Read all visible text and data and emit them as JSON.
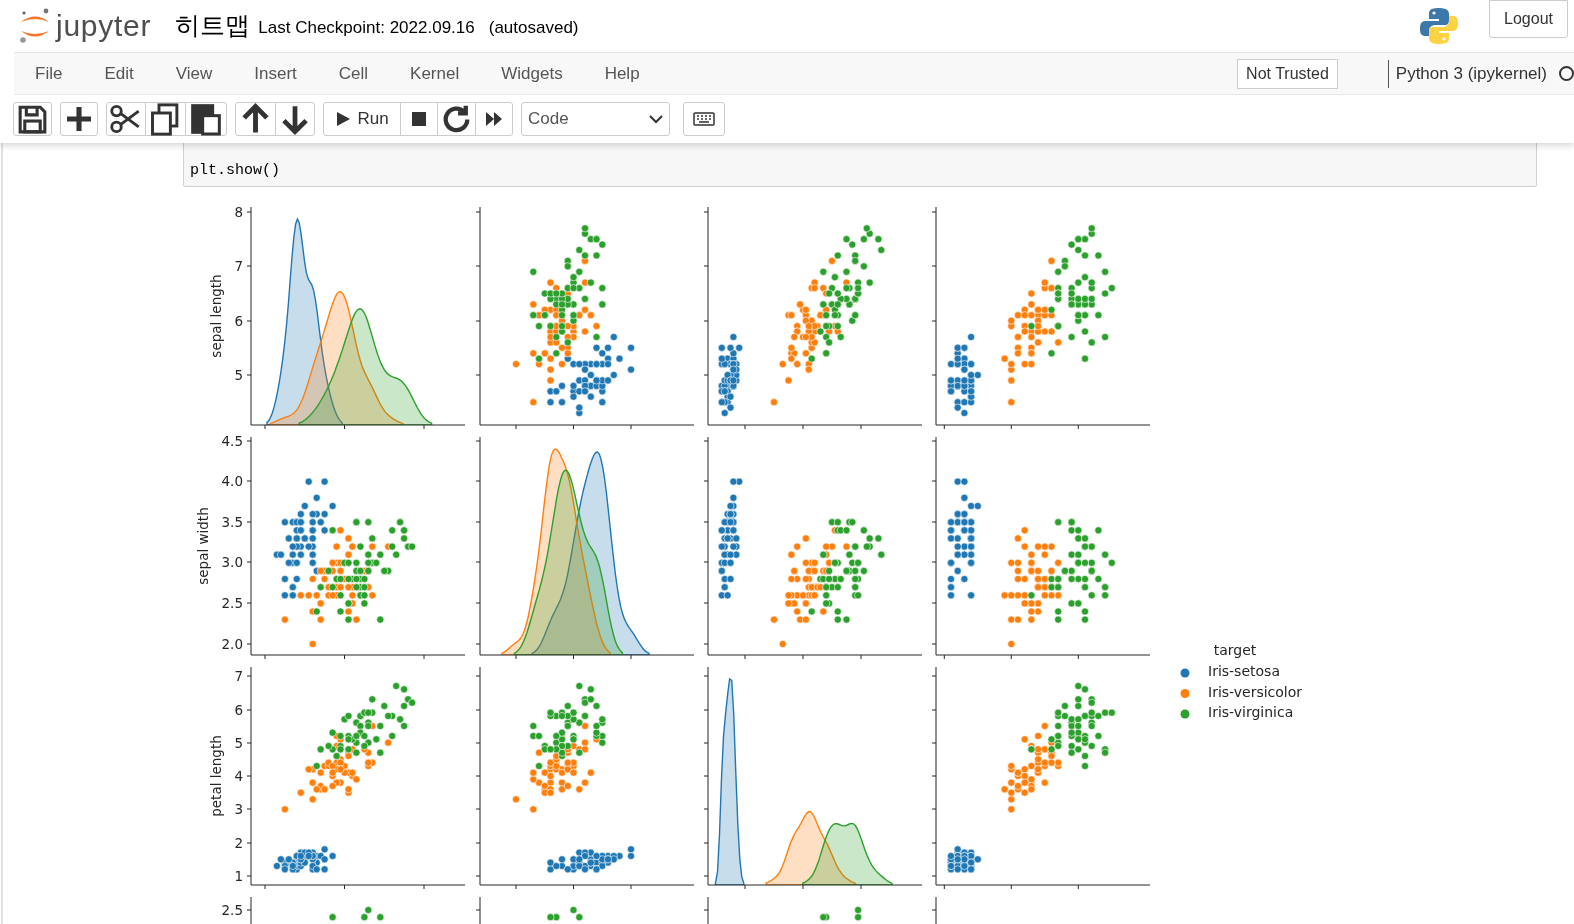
{
  "header": {
    "logo_text": "jupyter",
    "notebook_title": "히트맵",
    "checkpoint": "Last Checkpoint: 2022.09.16",
    "autosave_status": "(autosaved)",
    "logout": "Logout"
  },
  "menu": [
    {
      "label": "File"
    },
    {
      "label": "Edit"
    },
    {
      "label": "View"
    },
    {
      "label": "Insert"
    },
    {
      "label": "Cell"
    },
    {
      "label": "Kernel"
    },
    {
      "label": "Widgets"
    },
    {
      "label": "Help"
    }
  ],
  "trusted_status": "Not Trusted",
  "kernel": {
    "name": "Python 3 (ipykernel)",
    "busy": false
  },
  "toolbar": {
    "run_label": "Run",
    "cell_type": "Code"
  },
  "cell": {
    "lines": [
      "plt.show()"
    ]
  },
  "pairplot": {
    "variables": [
      {
        "label": "sepal length",
        "ticks": [
          "8",
          "7",
          "6",
          "5"
        ]
      },
      {
        "label": "sepal width",
        "ticks": [
          "4.5",
          "4.0",
          "3.5",
          "3.0",
          "2.5",
          "2.0"
        ]
      },
      {
        "label": "petal length",
        "ticks": [
          "7",
          "6",
          "5",
          "4",
          "3",
          "2",
          "1"
        ]
      },
      {
        "ticks": [
          "2.5"
        ]
      }
    ],
    "legend": {
      "title": "target",
      "items": [
        {
          "label": "Iris-setosa",
          "color": "#1f77b4"
        },
        {
          "label": "Iris-versicolor",
          "color": "#ff7f0e"
        },
        {
          "label": "Iris-virginica",
          "color": "#2ca02c"
        }
      ]
    }
  }
}
